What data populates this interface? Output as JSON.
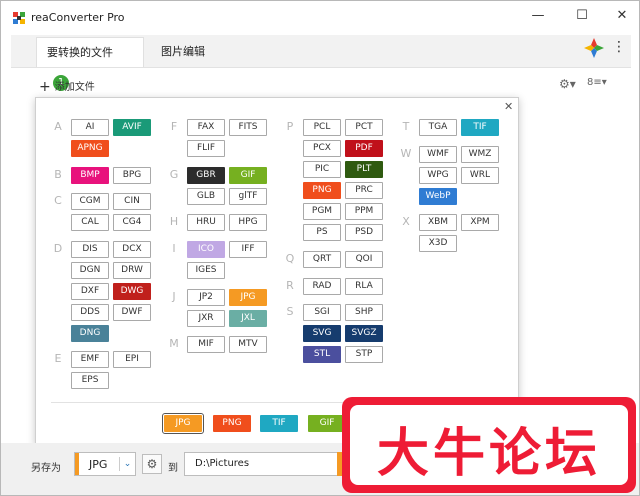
{
  "window": {
    "title": "reaConverter Pro",
    "min_label": "—",
    "max_label": "☐",
    "close_label": "✕"
  },
  "tabs": [
    {
      "label": "要转换的文件",
      "badge": "1"
    },
    {
      "label": "图片编辑"
    }
  ],
  "menu_icon": "⋮",
  "toolbar": {
    "add_icon": "+",
    "add_label": "添加文件",
    "gear": "⚙▾",
    "view": "8≡▾"
  },
  "popup": {
    "close": "✕"
  },
  "groups": {
    "A": [
      "AI",
      "AVIF",
      "APNG"
    ],
    "B": [
      "BMP",
      "BPG"
    ],
    "C": [
      "CGM",
      "CIN",
      "CAL",
      "CG4"
    ],
    "D": [
      "DIS",
      "DCX",
      "DGN",
      "DRW",
      "DXF",
      "DWG",
      "DDS",
      "DWF",
      "DNG"
    ],
    "E": [
      "EMF",
      "EPI",
      "EPS"
    ],
    "F": [
      "FAX",
      "FITS",
      "FLIF"
    ],
    "G": [
      "GBR",
      "GIF",
      "GLB",
      "glTF"
    ],
    "H": [
      "HRU",
      "HPG"
    ],
    "I": [
      "ICO",
      "IFF",
      "IGES"
    ],
    "J": [
      "JP2",
      "JPG",
      "JXR",
      "JXL"
    ],
    "M": [
      "MIF",
      "MTV"
    ],
    "P": [
      "PCL",
      "PCT",
      "PCX",
      "PDF",
      "PIC",
      "PLT",
      "PNG",
      "PRC",
      "PGM",
      "PPM",
      "PS",
      "PSD"
    ],
    "Q": [
      "QRT",
      "QOI"
    ],
    "R": [
      "RAD",
      "RLA"
    ],
    "S": [
      "SGI",
      "SHP",
      "SVG",
      "SVGZ",
      "STL",
      "STP"
    ],
    "T": [
      "TGA",
      "TIF"
    ],
    "W": [
      "WMF",
      "WMZ",
      "WPG",
      "WRL",
      "WebP"
    ],
    "X": [
      "XBM",
      "XPM",
      "X3D"
    ]
  },
  "colors": {
    "AVIF": "#1a9a78",
    "APNG": "#f04e1c",
    "BMP": "#e8127c",
    "DWG": "#c0201c",
    "DNG": "#4a8299",
    "GBR": "#2c2c2c",
    "GIF": "#76b020",
    "ICO": "#c0a8e4",
    "JPG": "#f59a23",
    "JXL": "#6aaea4",
    "PDF": "#c0101a",
    "PLT": "#2f5a10",
    "PNG": "#f04e1c",
    "SVG": "#163c6e",
    "SVGZ": "#163c6e",
    "STL": "#4b4f9e",
    "TIF": "#1fa8c2",
    "WebP": "#2f7cd3"
  },
  "quick": [
    "JPG",
    "PNG",
    "TIF",
    "GIF"
  ],
  "bottom": {
    "save_as": "另存为",
    "format": "JPG",
    "chevron": "⌄",
    "gear": "⚙",
    "to": "到",
    "path": "D:\\Pictures"
  },
  "watermark": "大牛论坛"
}
